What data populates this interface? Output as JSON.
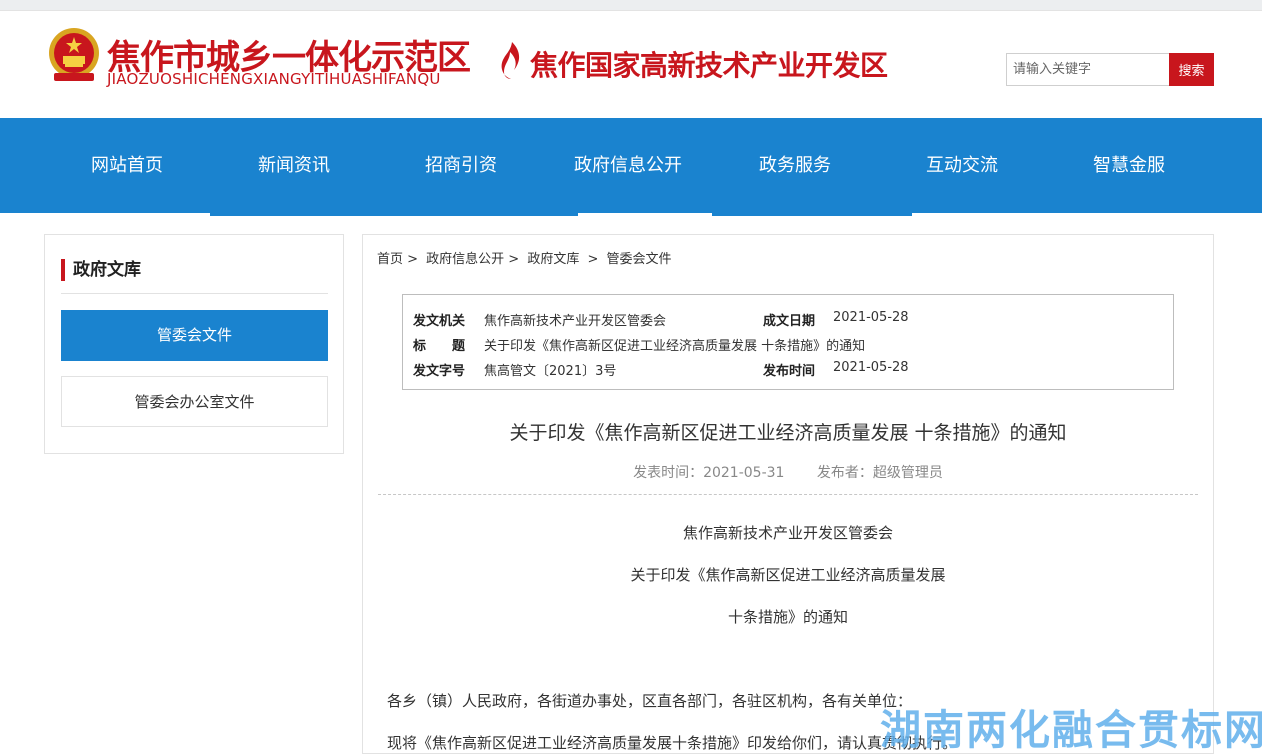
{
  "header": {
    "logo1_cn": "焦作市城乡一体化示范区",
    "logo1_pinyin": "JIAOZUOSHICHENGXIANGYITIHUASHIFANQU",
    "logo2_cn": "焦作国家高新技术产业开发区",
    "search_placeholder": "请输入关键字",
    "search_button": "搜索"
  },
  "nav": {
    "items": [
      "网站首页",
      "新闻资讯",
      "招商引资",
      "政府信息公开",
      "政务服务",
      "互动交流",
      "智慧金服"
    ]
  },
  "sidebar": {
    "title": "政府文库",
    "items": [
      "管委会文件",
      "管委会办公室文件"
    ]
  },
  "breadcrumb": [
    "首页 >",
    "政府信息公开 >",
    "政府文库",
    ">",
    "管委会文件"
  ],
  "meta": {
    "issuer_label": "发文机关",
    "issuer": "焦作高新技术产业开发区管委会",
    "date_label": "成文日期",
    "date": "2021-05-28",
    "title_label": "标　　题",
    "title": "关于印发《焦作高新区促进工业经济高质量发展 十条措施》的通知",
    "number_label": "发文字号",
    "number": "焦高管文〔2021〕3号",
    "publish_label": "发布时间",
    "publish": "2021-05-28"
  },
  "article": {
    "title": "关于印发《焦作高新区促进工业经济高质量发展 十条措施》的通知",
    "publish_time": "发表时间：2021-05-31",
    "publisher": "发布者：超级管理员",
    "lines": [
      "焦作高新技术产业开发区管委会",
      "关于印发《焦作高新区促进工业经济高质量发展",
      "十条措施》的通知"
    ],
    "paragraphs": [
      "各乡（镇）人民政府，各街道办事处，区直各部门，各驻区机构，各有关单位：",
      "现将《焦作高新区促进工业经济高质量发展十条措施》印发给你们，请认真贯彻执行。"
    ]
  },
  "watermark": "湖南两化融合贯标网",
  "colors": {
    "brand_red": "#c8161d",
    "nav_blue": "#1a83cf"
  }
}
